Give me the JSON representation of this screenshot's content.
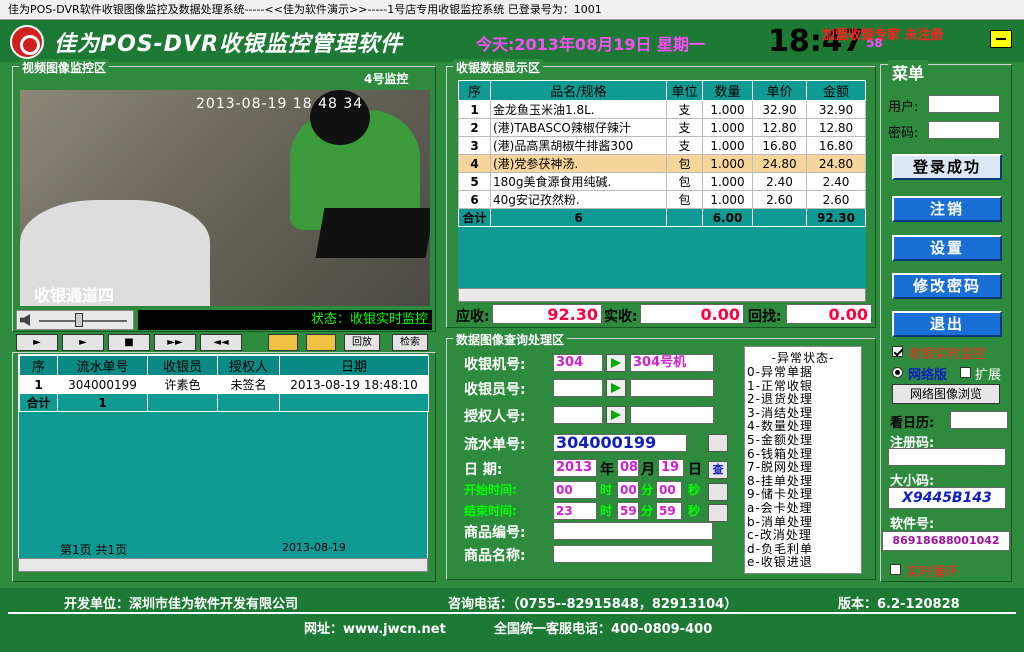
{
  "window": {
    "title": "佳为POS-DVR软件收银图像监控及数据处理系统-----<<佳为软件演示>>-----1号店专用收银监控系统              已登录号为：1001"
  },
  "header": {
    "app_title": "佳为POS-DVR收银监控管理软件",
    "today": "今天:2013年08月19日  星期一",
    "clock": "18:47",
    "clock_sec": "58",
    "reg_tip": "加盟收银专家  未注册"
  },
  "video": {
    "panel_title": "视频图像监控区",
    "channel": "4号监控",
    "timestamp": "2013-08-19 18 48 34",
    "overlay": "收银通道四",
    "status": "状态：收银实时监控"
  },
  "controls": {
    "play": "►",
    "stop": "■",
    "fast": "►►",
    "rewind": "◄◄",
    "replay": "回放",
    "search": "检索"
  },
  "record_grid": {
    "headers": [
      "序",
      "流水单号",
      "收银员",
      "授权人",
      "日期"
    ],
    "rows": [
      [
        "1",
        "304000199",
        "许素色",
        "未签名",
        "2013-08-19 18:48:10"
      ]
    ],
    "sum_label": "合计",
    "sum_count": "1",
    "page_info": "第1页 共1页",
    "page_date": "2013-08-19"
  },
  "cash_data": {
    "panel_title": "收银数据显示区",
    "headers": [
      "序",
      "品名/规格",
      "单位",
      "数量",
      "单价",
      "金额"
    ],
    "rows": [
      [
        "1",
        "金龙鱼玉米油1.8L.",
        "支",
        "1.000",
        "32.90",
        "32.90"
      ],
      [
        "2",
        "(港)TABASCO辣椒仔辣汁",
        "支",
        "1.000",
        "12.80",
        "12.80"
      ],
      [
        "3",
        "(港)品高黑胡椒牛排酱300",
        "支",
        "1.000",
        "16.80",
        "16.80"
      ],
      [
        "4",
        "(港)党参茯神汤.",
        "包",
        "1.000",
        "24.80",
        "24.80"
      ],
      [
        "5",
        "180g美食源食用纯碱.",
        "包",
        "1.000",
        "2.40",
        "2.40"
      ],
      [
        "6",
        "40g安记孜然粉.",
        "包",
        "1.000",
        "2.60",
        "2.60"
      ]
    ],
    "selected_row": 4,
    "sum_label": "合计",
    "sum_count": "6",
    "sum_qty": "6.00",
    "sum_amount": "92.30",
    "due_label": "应收:",
    "due": "92.30",
    "paid_label": "实收:",
    "paid": "0.00",
    "change_label": "回找:",
    "change": "0.00"
  },
  "query": {
    "panel_title": "数据图像查询处理区",
    "register_label": "收银机号:",
    "register_value": "304",
    "register_select": "304号机",
    "cashier_label": "收银员号:",
    "auth_label": "授权人号:",
    "serial_label": "流水单号:",
    "serial_value": "304000199",
    "date_label": "日    期:",
    "year": "2013",
    "year_unit": "年",
    "month": "08",
    "month_unit": "月",
    "day": "19",
    "day_unit": "日",
    "start_label": "开始时间:",
    "start_h": "00",
    "start_m": "00",
    "start_s": "00",
    "end_label": "结束时间:",
    "end_h": "23",
    "end_m": "59",
    "end_s": "59",
    "h_unit": "时",
    "m_unit": "分",
    "s_unit": "秒",
    "query_btn": "查",
    "item_code_label": "商品编号:",
    "item_name_label": "商品名称:"
  },
  "exceptions": {
    "title": "-异常状态-",
    "items": [
      "0-异常单据",
      "1-正常收银",
      "2-退货处理",
      "3-消结处理",
      "4-数量处理",
      "5-金额处理",
      "6-钱箱处理",
      "7-脱网处理",
      "8-挂单处理",
      "9-储卡处理",
      "a-会卡处理",
      "b-消单处理",
      "c-改消处理",
      "d-负毛利单",
      "e-收银进退"
    ]
  },
  "menu": {
    "title": "菜单",
    "user_label": "用户:",
    "password_label": "密码:",
    "login_btn": "登录成功",
    "logout_btn": "注销",
    "settings_btn": "设置",
    "change_pwd_btn": "修改密码",
    "exit_btn": "退出",
    "realtime_label": "收银实时监控",
    "net_label": "网络版",
    "ext_label": "扩展",
    "net_browse_btn": "网络图像浏览",
    "calendar_label": "看日历:",
    "regcode_label": "注册码:",
    "bigcode_label": "大小码:",
    "bigcode_value": "X9445B143",
    "serial_label": "软件号:",
    "serial_value": "86918688001042",
    "loop_label": "实时循环"
  },
  "footer": {
    "developer": "开发单位：深圳市佳为软件开发有限公司",
    "phone": "咨询电话：（0755--82915848，82913104）",
    "version": "版本：6.2-120828",
    "website": "网址：www.jwcn.net",
    "hotline": "全国统一客服电话：400-0809-400"
  },
  "colors": {
    "background": "#2e8b3e",
    "grid": "#0f9a94",
    "accent_magenta": "#ff4aff",
    "alert_red": "#ff0040",
    "button_blue": "#1a6fd6"
  }
}
